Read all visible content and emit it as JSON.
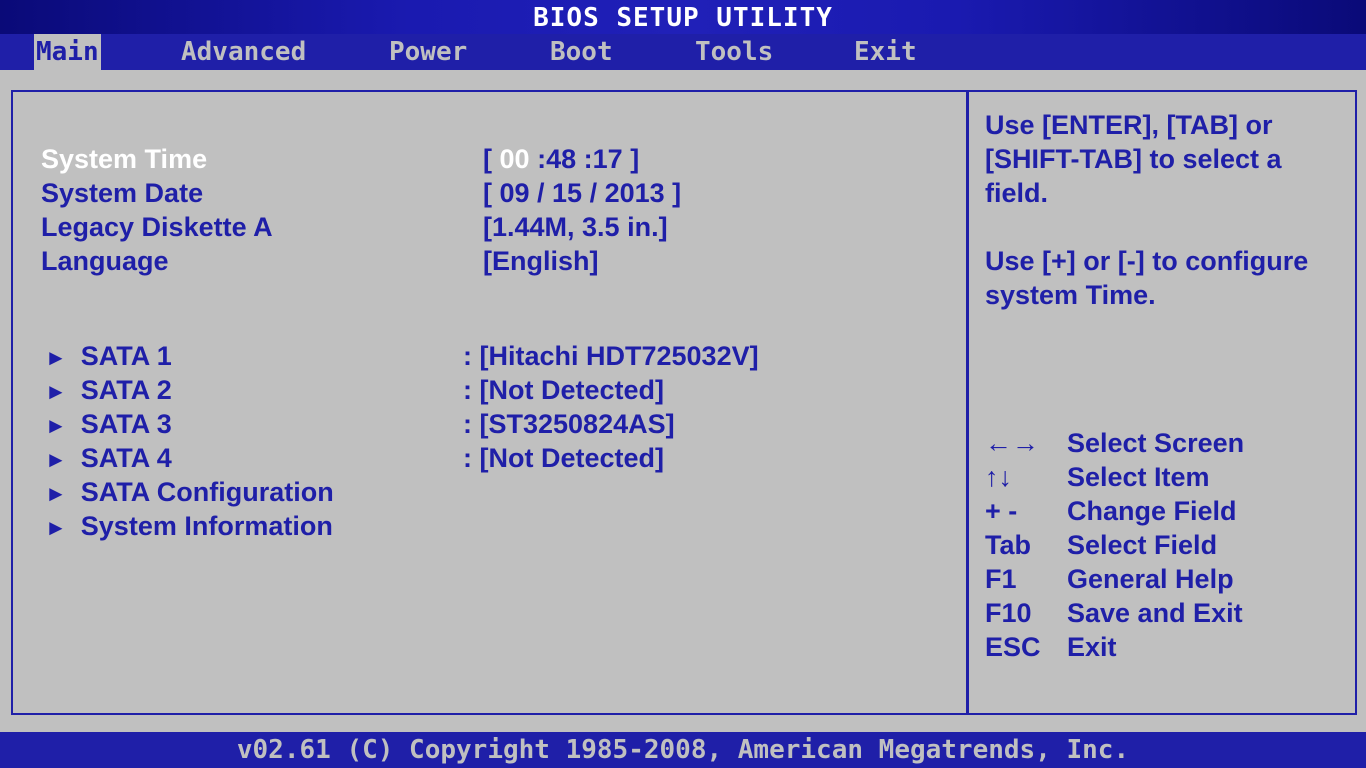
{
  "title": "BIOS SETUP UTILITY",
  "menu": [
    {
      "label": "Main"
    },
    {
      "label": "Advanced"
    },
    {
      "label": "Power"
    },
    {
      "label": "Boot"
    },
    {
      "label": "Tools"
    },
    {
      "label": "Exit"
    }
  ],
  "active_menu": "Main",
  "settings": {
    "system_time": {
      "label": "System Time",
      "open": "[",
      "hour": "00",
      "sep1": ":",
      "minute": "48",
      "sep2": ":",
      "second": "17",
      "close": "]"
    },
    "system_date": {
      "label": "System Date",
      "value": "[ 09 / 15 / 2013 ]"
    },
    "legacy_diskette": {
      "label": "Legacy Diskette A",
      "value": "[1.44M, 3.5 in.]"
    },
    "language": {
      "label": "Language",
      "value": "[English]"
    }
  },
  "submenus": [
    {
      "arrow": "►",
      "label": "SATA 1",
      "value": ": [Hitachi HDT725032V]"
    },
    {
      "arrow": "►",
      "label": "SATA 2",
      "value": ": [Not Detected]"
    },
    {
      "arrow": "►",
      "label": "SATA 3",
      "value": ": [ST3250824AS]"
    },
    {
      "arrow": "►",
      "label": "SATA 4",
      "value": ": [Not Detected]"
    },
    {
      "arrow": "►",
      "label": "SATA Configuration",
      "value": ""
    },
    {
      "arrow": "►",
      "label": "System Information",
      "value": ""
    }
  ],
  "help": {
    "text1": "Use [ENTER], [TAB] or [SHIFT-TAB] to select a field.",
    "text2": "Use [+] or [-] to configure system Time.",
    "keys": [
      {
        "key": "←→",
        "desc": "Select Screen"
      },
      {
        "key": "↑↓",
        "desc": "Select Item"
      },
      {
        "key": "+ -",
        "desc": "Change Field"
      },
      {
        "key": "Tab",
        "desc": "Select Field"
      },
      {
        "key": "F1",
        "desc": "General Help"
      },
      {
        "key": "F10",
        "desc": "Save and Exit"
      },
      {
        "key": "ESC",
        "desc": "Exit"
      }
    ]
  },
  "footer": "v02.61 (C) Copyright 1985-2008, American Megatrends, Inc.",
  "colors": {
    "background": "#c0c0c0",
    "blue": "#1f1fa8",
    "highlight": "#ffffff"
  }
}
